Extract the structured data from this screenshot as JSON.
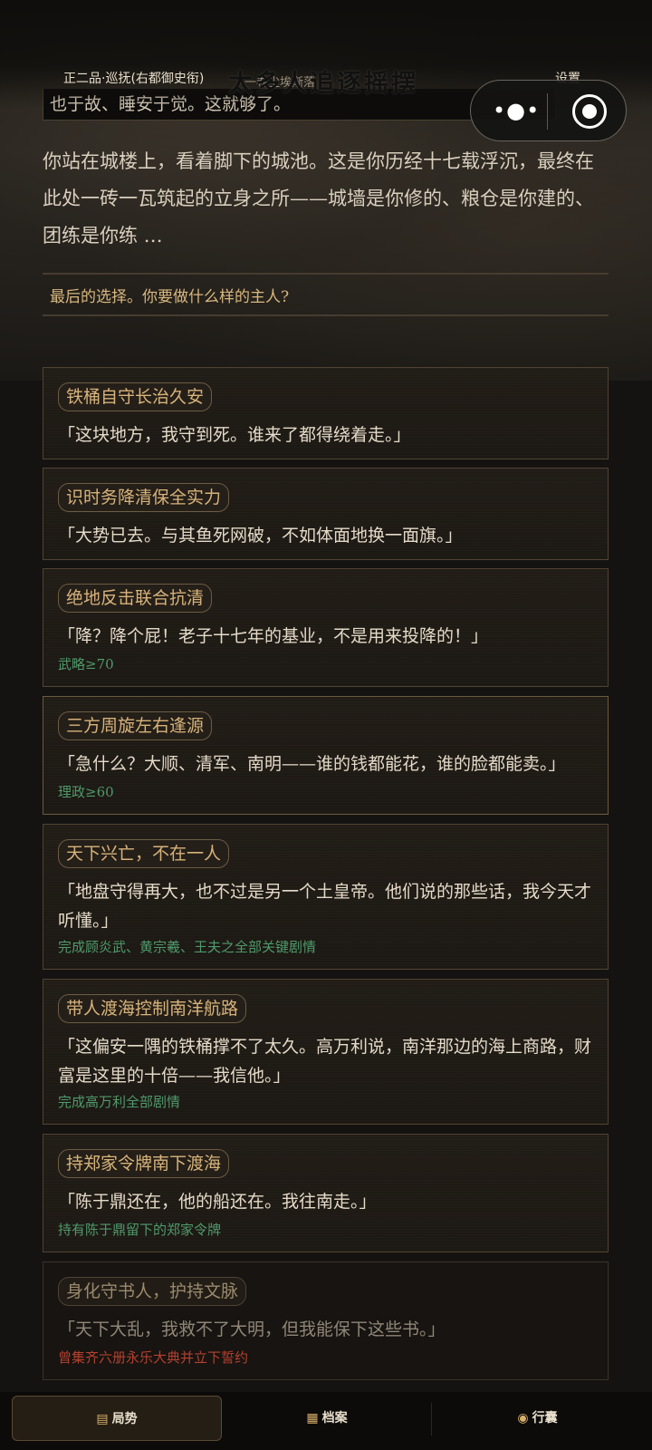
{
  "header": {
    "rank": "正二品·巡抚(右都御史衔)",
    "sub_caption": "一卷尘埃渐落",
    "title": "太多人追逐摇摆",
    "settings_label": "设置"
  },
  "capsule": {
    "more_icon": "more-dots-icon",
    "close_icon": "target-close-icon"
  },
  "story": {
    "previous_text": "也于故、睡安于觉。这就够了。",
    "narration": "你站在城楼上，看着脚下的城池。这是你历经十七载浮沉，最终在此处一砖一瓦筑起的立身之所——城墙是你修的、粮仓是你建的、团练是你练 …",
    "prompt": "最后的选择。你要做什么样的主人?"
  },
  "choices": [
    {
      "tag": "铁桶自守长治久安",
      "quote": "「这块地方，我守到死。谁来了都得绕着走。」",
      "requirement": ""
    },
    {
      "tag": "识时务降清保全实力",
      "quote": "「大势已去。与其鱼死网破，不如体面地换一面旗。」",
      "requirement": ""
    },
    {
      "tag": "绝地反击联合抗清",
      "quote": "「降？降个屁！老子十七年的基业，不是用来投降的！」",
      "requirement": "武略≥70"
    },
    {
      "tag": "三方周旋左右逢源",
      "quote": "「急什么？大顺、清军、南明——谁的钱都能花，谁的脸都能卖。」",
      "requirement": "理政≥60"
    },
    {
      "tag": "天下兴亡，不在一人",
      "quote": "「地盘守得再大，也不过是另一个土皇帝。他们说的那些话，我今天才听懂。」",
      "requirement": "完成顾炎武、黄宗羲、王夫之全部关键剧情"
    },
    {
      "tag": "带人渡海控制南洋航路",
      "quote": "「这偏安一隅的铁桶撑不了太久。高万利说，南洋那边的海上商路，财富是这里的十倍——我信他。」",
      "requirement": "完成高万利全部剧情"
    },
    {
      "tag": "持郑家令牌南下渡海",
      "quote": "「陈于鼎还在，他的船还在。我往南走。」",
      "requirement": "持有陈于鼎留下的郑家令牌"
    },
    {
      "tag": "身化守书人，护持文脉",
      "quote": "「天下大乱，我救不了大明，但我能保下这些书。」",
      "requirement": "曾集齐六册永乐大典并立下誓约"
    }
  ],
  "nav": [
    {
      "icon": "scroll-icon",
      "label": "局势"
    },
    {
      "icon": "archive-icon",
      "label": "档案"
    },
    {
      "icon": "money-bag-icon",
      "label": "行囊"
    }
  ],
  "colors": {
    "accent_gold": "#d7b37a",
    "requirement_green": "#4e9a6b",
    "requirement_red": "#b5412f"
  }
}
